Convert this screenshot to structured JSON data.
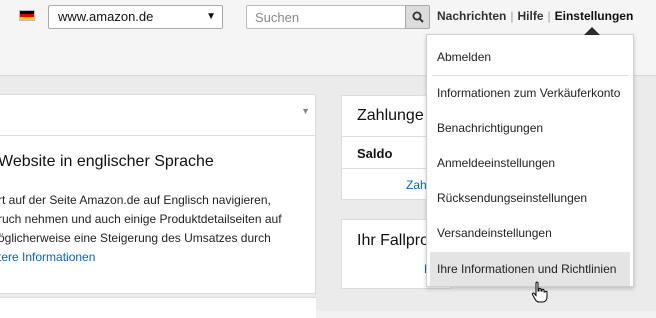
{
  "header": {
    "flag_icon": "german-flag-icon",
    "marketplace": {
      "value": "www.amazon.de"
    },
    "search": {
      "placeholder": "Suchen",
      "icon": "search-icon"
    },
    "links": [
      {
        "label": "Nachrichten"
      },
      {
        "label": "Hilfe"
      },
      {
        "label": "Einstellungen",
        "active": true
      }
    ]
  },
  "dropdown": {
    "items": [
      {
        "label": "Abmelden"
      },
      {
        "label": "Informationen zum Verkäuferkonto"
      },
      {
        "label": "Benachrichtigungen"
      },
      {
        "label": "Anmeldeeinstellungen"
      },
      {
        "label": "Rücksendungseinstellungen"
      },
      {
        "label": "Versandeinstellungen"
      },
      {
        "label": "Ihre Informationen und Richtlinien",
        "hovered": true
      }
    ]
  },
  "main_card": {
    "heading": "Website in englischer Sprache",
    "lines": [
      "rt auf der Seite Amazon.de auf Englisch navigieren,",
      "ruch nehmen und auch einige Produktdetailseiten auf",
      "öglicherweise eine Steigerung des Umsatzes durch"
    ],
    "link": "tere Informationen"
  },
  "payments_card": {
    "title": "Zahlunge",
    "saldo_label": "Saldo",
    "link": "Zah"
  },
  "cases_card": {
    "title": "Ihr Fallpro",
    "link": "F"
  },
  "colors": {
    "link": "#0066c0",
    "hover": "#e4e4e4",
    "background": "#ebebeb"
  }
}
